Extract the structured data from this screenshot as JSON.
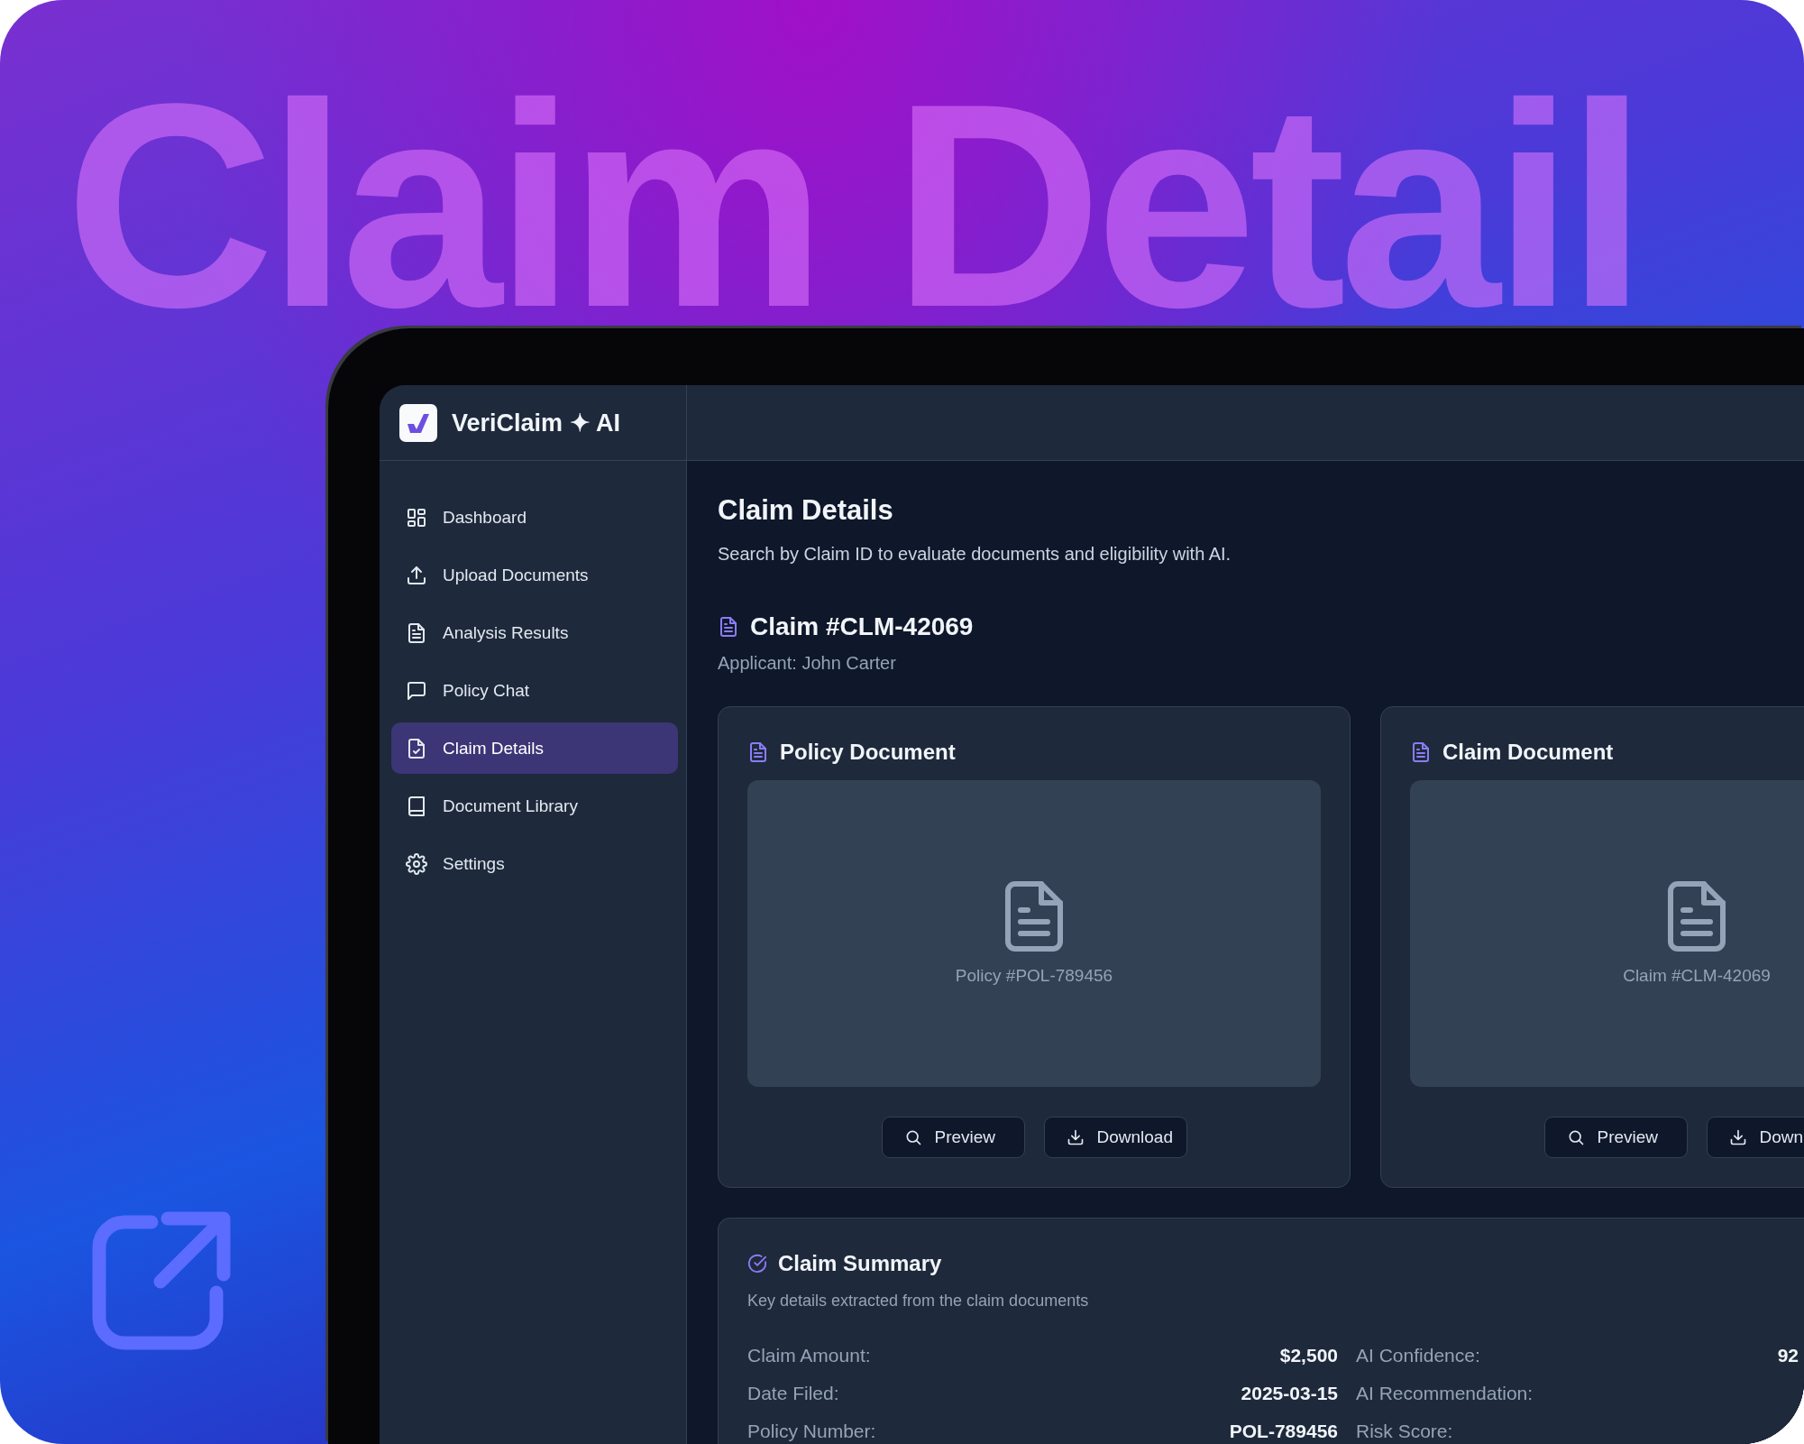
{
  "hero": {
    "title": "Claim Detail"
  },
  "app": {
    "brand": "VeriClaim ✦ AI"
  },
  "sidebar": {
    "items": [
      {
        "label": "Dashboard",
        "kind": "dashboard",
        "selected": false
      },
      {
        "label": "Upload Documents",
        "kind": "upload",
        "selected": false
      },
      {
        "label": "Analysis Results",
        "kind": "results",
        "selected": false
      },
      {
        "label": "Policy Chat",
        "kind": "chat",
        "selected": false
      },
      {
        "label": "Claim Details",
        "kind": "claim",
        "selected": true
      },
      {
        "label": "Document Library",
        "kind": "library",
        "selected": false
      },
      {
        "label": "Settings",
        "kind": "settings",
        "selected": false
      }
    ]
  },
  "page": {
    "title": "Claim Details",
    "subtitle": "Search by Claim ID to evaluate documents and eligibility with AI."
  },
  "claim": {
    "title": "Claim #CLM-42069",
    "applicant": "Applicant: John Carter"
  },
  "documents": [
    {
      "title": "Policy Document",
      "caption": "Policy #POL-789456",
      "buttons": [
        {
          "label": "Preview",
          "kind": "preview"
        },
        {
          "label": "Download",
          "kind": "download"
        }
      ]
    },
    {
      "title": "Claim Document",
      "caption": "Claim #CLM-42069",
      "buttons": [
        {
          "label": "Preview",
          "kind": "preview"
        },
        {
          "label": "Down",
          "kind": "download"
        }
      ]
    }
  ],
  "summary": {
    "title": "Claim Summary",
    "subtitle": "Key details extracted from the claim documents",
    "left": [
      {
        "label": "Claim Amount:",
        "value": "$2,500"
      },
      {
        "label": "Date Filed:",
        "value": "2025-03-15"
      },
      {
        "label": "Policy Number:",
        "value": "POL-789456"
      }
    ],
    "right": [
      {
        "label": "AI Confidence:",
        "value": "92"
      },
      {
        "label": "AI Recommendation:"
      },
      {
        "label": "Risk Score:"
      }
    ]
  }
}
